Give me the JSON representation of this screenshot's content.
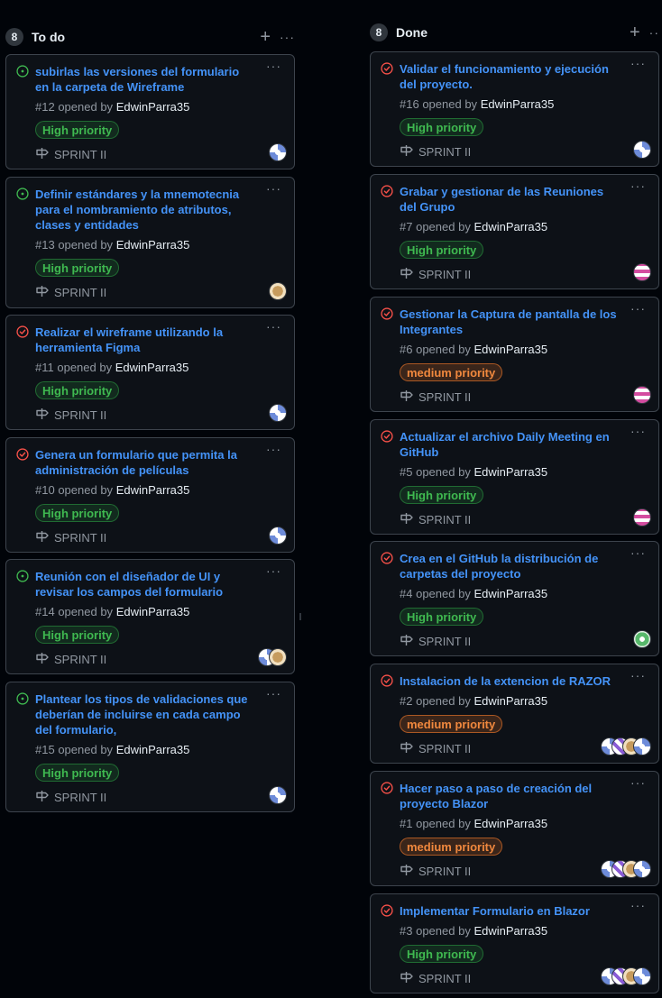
{
  "columns": [
    {
      "count": "8",
      "title": "To do",
      "add_label": "+",
      "menu_label": "···",
      "cards": [
        {
          "status": "open",
          "title": "subirlas las versiones del formulario en la carpeta de Wireframe",
          "number": "#12",
          "opened_by": "opened by",
          "author": "EdwinParra35",
          "label": "High priority",
          "label_type": "high",
          "milestone": "SPRINT II",
          "avatars": [
            "av-blue"
          ]
        },
        {
          "status": "open",
          "title": "Definir estándares y la mnemotecnia para el nombramiento de atributos, clases y entidades",
          "number": "#13",
          "opened_by": "opened by",
          "author": "EdwinParra35",
          "label": "High priority",
          "label_type": "high",
          "milestone": "SPRINT II",
          "avatars": [
            "av-gold"
          ]
        },
        {
          "status": "closed",
          "title": "Realizar el wireframe utilizando la herramienta Figma",
          "number": "#11",
          "opened_by": "opened by",
          "author": "EdwinParra35",
          "label": "High priority",
          "label_type": "high",
          "milestone": "SPRINT II",
          "avatars": [
            "av-blue"
          ]
        },
        {
          "status": "closed",
          "title": "Genera un formulario que permita la administración de películas",
          "number": "#10",
          "opened_by": "opened by",
          "author": "EdwinParra35",
          "label": "High priority",
          "label_type": "high",
          "milestone": "SPRINT II",
          "avatars": [
            "av-blue"
          ]
        },
        {
          "status": "open",
          "title": "Reunión con el diseñador de UI y revisar los campos del formulario",
          "number": "#14",
          "opened_by": "opened by",
          "author": "EdwinParra35",
          "label": "High priority",
          "label_type": "high",
          "milestone": "SPRINT II",
          "avatars": [
            "av-gold",
            "av-blue"
          ]
        },
        {
          "status": "open",
          "title": "Plantear los tipos de validaciones que deberían de incluirse en cada campo del formulario,",
          "number": "#15",
          "opened_by": "opened by",
          "author": "EdwinParra35",
          "label": "High priority",
          "label_type": "high",
          "milestone": "SPRINT II",
          "avatars": [
            "av-blue"
          ]
        }
      ]
    },
    {
      "count": "8",
      "title": "Done",
      "add_label": "+",
      "menu_label": "··",
      "cards": [
        {
          "status": "closed",
          "title": "Validar el funcionamiento y ejecución del proyecto.",
          "number": "#16",
          "opened_by": "opened by",
          "author": "EdwinParra35",
          "label": "High priority",
          "label_type": "high",
          "milestone": "SPRINT II",
          "avatars": [
            "av-blue"
          ]
        },
        {
          "status": "closed",
          "title": "Grabar y gestionar de las Reuniones del Grupo",
          "number": "#7",
          "opened_by": "opened by",
          "author": "EdwinParra35",
          "label": "High priority",
          "label_type": "high",
          "milestone": "SPRINT II",
          "avatars": [
            "av-pink"
          ]
        },
        {
          "status": "closed",
          "title": "Gestionar la Captura de pantalla de los Integrantes",
          "number": "#6",
          "opened_by": "opened by",
          "author": "EdwinParra35",
          "label": "medium priority",
          "label_type": "medium",
          "milestone": "SPRINT II",
          "avatars": [
            "av-pink"
          ]
        },
        {
          "status": "closed",
          "title": "Actualizar el archivo Daily Meeting en GitHub",
          "number": "#5",
          "opened_by": "opened by",
          "author": "EdwinParra35",
          "label": "High priority",
          "label_type": "high",
          "milestone": "SPRINT II",
          "avatars": [
            "av-pink"
          ]
        },
        {
          "status": "closed",
          "title": "Crea en el GitHub la distribución de carpetas del proyecto",
          "number": "#4",
          "opened_by": "opened by",
          "author": "EdwinParra35",
          "label": "High priority",
          "label_type": "high",
          "milestone": "SPRINT II",
          "avatars": [
            "av-green"
          ]
        },
        {
          "status": "closed",
          "title": "Instalacion de la extencion de RAZOR",
          "number": "#2",
          "opened_by": "opened by",
          "author": "EdwinParra35",
          "label": "medium priority",
          "label_type": "medium",
          "milestone": "SPRINT II",
          "avatars": [
            "av-blue",
            "av-gold",
            "av-purple",
            "av-blue"
          ]
        },
        {
          "status": "closed",
          "title": "Hacer paso a paso de creación del proyecto Blazor",
          "number": "#1",
          "opened_by": "opened by",
          "author": "EdwinParra35",
          "label": "medium priority",
          "label_type": "medium",
          "milestone": "SPRINT II",
          "avatars": [
            "av-blue",
            "av-gold",
            "av-purple",
            "av-blue"
          ]
        },
        {
          "status": "closed",
          "title": "Implementar Formulario en Blazor",
          "number": "#3",
          "opened_by": "opened by",
          "author": "EdwinParra35",
          "label": "High priority",
          "label_type": "high",
          "milestone": "SPRINT II",
          "avatars": [
            "av-blue",
            "av-gold",
            "av-purple",
            "av-blue"
          ]
        }
      ]
    }
  ],
  "colors": {
    "open": "#3fb950",
    "closed": "#f85149",
    "link": "#4493f8",
    "background": "#010409",
    "card": "#0d1117"
  },
  "icons": {
    "open": "issue-opened-icon",
    "closed": "issue-closed-icon",
    "milestone": "milestone-icon"
  }
}
